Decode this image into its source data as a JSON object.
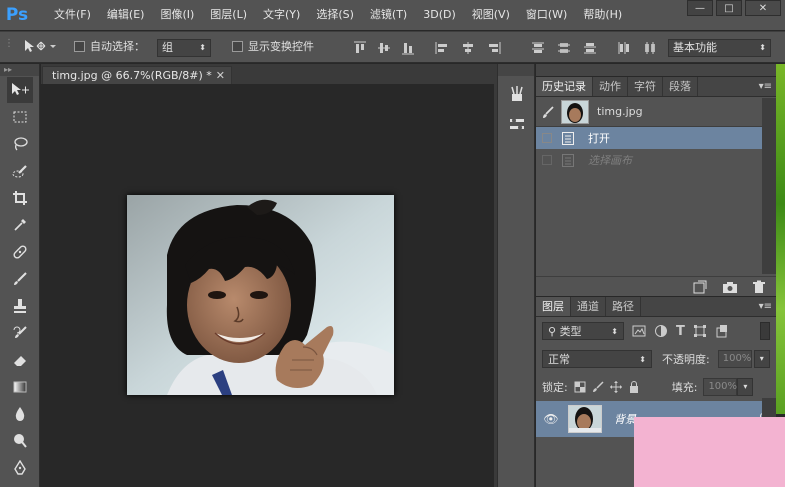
{
  "app": {
    "logo": "Ps",
    "menu": [
      "文件(F)",
      "编辑(E)",
      "图像(I)",
      "图层(L)",
      "文字(Y)",
      "选择(S)",
      "滤镜(T)",
      "3D(D)",
      "视图(V)",
      "窗口(W)",
      "帮助(H)"
    ],
    "window_controls": {
      "minimize": "—",
      "maximize": "□",
      "close": "✕"
    }
  },
  "options": {
    "auto_select_label": "自动选择：",
    "auto_select_value": "组",
    "show_transform_label": "显示变换控件",
    "workspace": "基本功能"
  },
  "document": {
    "tab_title": "timg.jpg @ 66.7%(RGB/8#) *",
    "close": "✕"
  },
  "history_panel": {
    "tabs": [
      "历史记录",
      "动作",
      "字符",
      "段落"
    ],
    "snapshot_name": "timg.jpg",
    "states": [
      {
        "label": "打开",
        "active": true
      },
      {
        "label": "选择画布",
        "active": false
      }
    ]
  },
  "layers_panel": {
    "tabs": [
      "图层",
      "通道",
      "路径"
    ],
    "filter_kind": "类型",
    "blend_mode": "正常",
    "opacity_label": "不透明度:",
    "opacity_value": "100%",
    "lock_label": "锁定:",
    "fill_label": "填充:",
    "fill_value": "100%",
    "layers": [
      {
        "name": "背景",
        "visible": true,
        "locked": true
      }
    ]
  },
  "colors": {
    "ui_bg": "#535353",
    "canvas_bg": "#282828",
    "selection": "#6c84a0",
    "ps_blue": "#3ba0ff"
  }
}
